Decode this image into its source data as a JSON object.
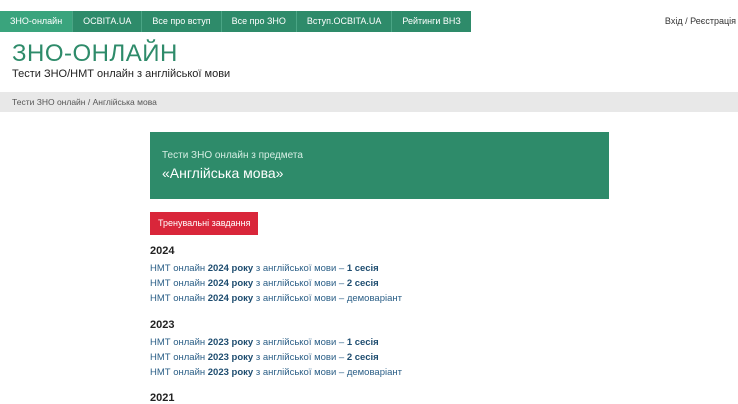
{
  "nav": {
    "items": [
      {
        "label": "ЗНО-онлайн",
        "active": true
      },
      {
        "label": "ОСВІТА.UA"
      },
      {
        "label": "Все про вступ"
      },
      {
        "label": "Все про ЗНО"
      },
      {
        "label": "Вступ.OCBITA.UA"
      },
      {
        "label": "Рейтинги ВНЗ"
      }
    ],
    "login": "Вхід",
    "separator": "/",
    "register": "Реєстрація"
  },
  "header": {
    "title": "ЗНО-ОНЛАЙН",
    "subtitle": "Тести ЗНО/НМТ онлайн з англійської мови"
  },
  "breadcrumb": "Тести ЗНО онлайн / Англійська мова",
  "card": {
    "subtitle": "Тести ЗНО онлайн з предмета",
    "subject": "«Англійська мова»"
  },
  "training_button": "Тренувальні завдання",
  "years": [
    {
      "year": "2024",
      "links": [
        {
          "pre": "НМТ онлайн ",
          "year_bold": "2024 року",
          "mid": " з англійської мови – ",
          "session_bold": "1 сесія",
          "post": ""
        },
        {
          "pre": "НМТ онлайн ",
          "year_bold": "2024 року",
          "mid": " з англійської мови – ",
          "session_bold": "2 сесія",
          "post": ""
        },
        {
          "pre": "НМТ онлайн ",
          "year_bold": "2024 року",
          "mid": " з англійської мови – демоваріант",
          "session_bold": "",
          "post": ""
        }
      ]
    },
    {
      "year": "2023",
      "links": [
        {
          "pre": "НМТ онлайн ",
          "year_bold": "2023 року",
          "mid": " з англійської мови – ",
          "session_bold": "1 сесія",
          "post": ""
        },
        {
          "pre": "НМТ онлайн ",
          "year_bold": "2023 року",
          "mid": " з англійської мови – ",
          "session_bold": "2 сесія",
          "post": ""
        },
        {
          "pre": "НМТ онлайн ",
          "year_bold": "2023 року",
          "mid": " з англійської мови – демоваріант",
          "session_bold": "",
          "post": ""
        }
      ]
    },
    {
      "year": "2021",
      "links": []
    }
  ]
}
